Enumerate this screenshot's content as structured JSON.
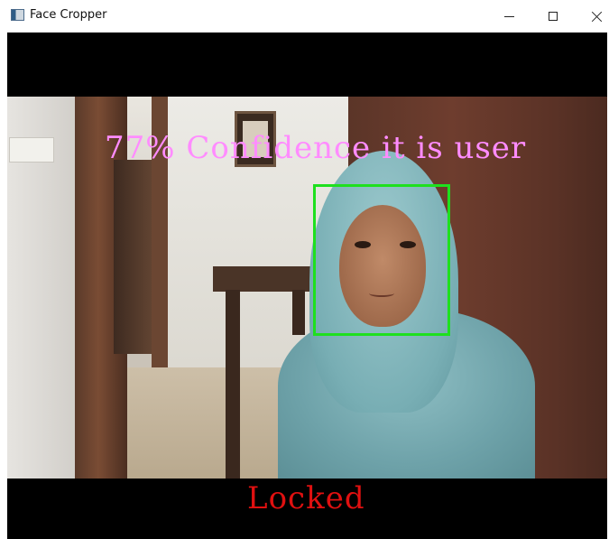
{
  "window": {
    "title": "Face Cropper",
    "icon": "app-window-icon",
    "controls": {
      "minimize_icon": "minimize-icon",
      "maximize_icon": "maximize-icon",
      "close_icon": "close-icon"
    }
  },
  "camera_feed": {
    "overlay_text": "77% Confidence it is user",
    "overlay_color": "#ff8cff",
    "status_text": "Locked",
    "status_color": "#e01010",
    "face_box_color": "#1ee01e"
  }
}
